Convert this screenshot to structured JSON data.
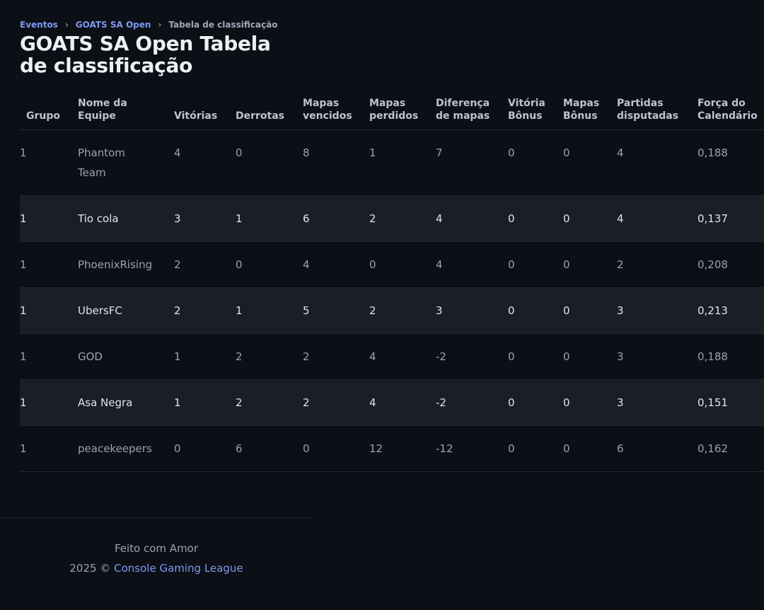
{
  "breadcrumb": {
    "items": [
      "Eventos",
      "GOATS SA Open"
    ],
    "current": "Tabela de classificação",
    "separator": "›"
  },
  "page": {
    "title": "GOATS SA Open Tabela de classificação"
  },
  "table": {
    "columns": [
      "Grupo",
      "Nome da Equipe",
      "Vitórias",
      "Derrotas",
      "Mapas vencidos",
      "Mapas perdidos",
      "Diferença de mapas",
      "Vitória Bônus",
      "Mapas Bônus",
      "Partidas disputadas",
      "Força do Calendário"
    ],
    "rows": [
      [
        "1",
        "Phantom Team",
        "4",
        "0",
        "8",
        "1",
        "7",
        "0",
        "0",
        "4",
        "0,188"
      ],
      [
        "1",
        "Tio cola",
        "3",
        "1",
        "6",
        "2",
        "4",
        "0",
        "0",
        "4",
        "0,137"
      ],
      [
        "1",
        "PhoenixRising",
        "2",
        "0",
        "4",
        "0",
        "4",
        "0",
        "0",
        "2",
        "0,208"
      ],
      [
        "1",
        "UbersFC",
        "2",
        "1",
        "5",
        "2",
        "3",
        "0",
        "0",
        "3",
        "0,213"
      ],
      [
        "1",
        "GOD",
        "1",
        "2",
        "2",
        "4",
        "-2",
        "0",
        "0",
        "3",
        "0,188"
      ],
      [
        "1",
        "Asa Negra",
        "1",
        "2",
        "2",
        "4",
        "-2",
        "0",
        "0",
        "3",
        "0,151"
      ],
      [
        "1",
        "peacekeepers",
        "0",
        "6",
        "0",
        "12",
        "-12",
        "0",
        "0",
        "6",
        "0,162"
      ]
    ]
  },
  "footer": {
    "made_with": "Feito com Amor",
    "copyright": "2025 ©",
    "link": "Console Gaming League"
  },
  "colors": {
    "background": "#0d0f17",
    "striped_row": "#1b1e26",
    "link": "#7d9bef"
  }
}
